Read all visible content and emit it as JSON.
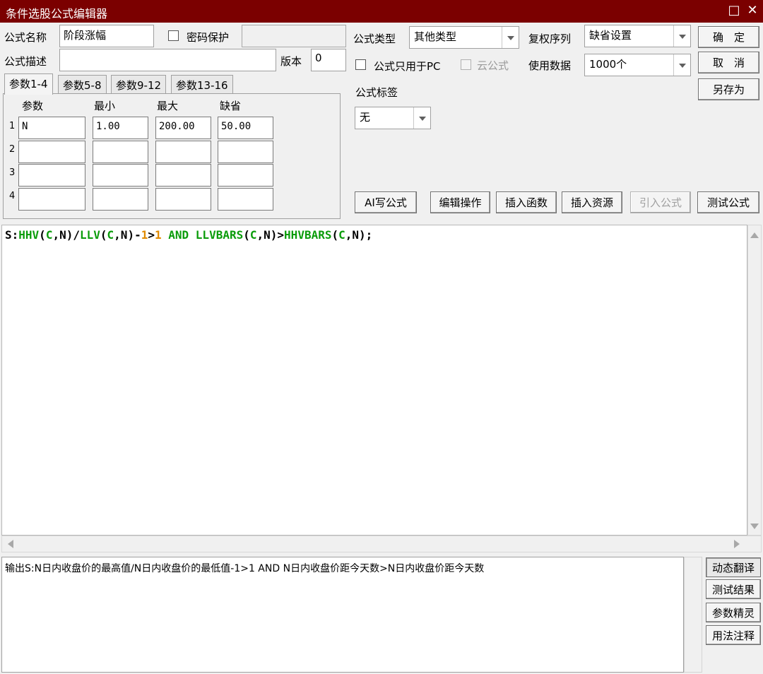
{
  "window": {
    "title": "条件选股公式编辑器",
    "titlebar_color": "#7b0000",
    "controls": {
      "maximize": "□",
      "close": "✕"
    }
  },
  "form": {
    "name_label": "公式名称",
    "name_value": "阶段涨幅",
    "password_label": "密码保护",
    "password_checked": false,
    "desc_label": "公式描述",
    "desc_value": "",
    "version_label": "版本",
    "version_value": "0",
    "type_label": "公式类型",
    "type_value": "其他类型",
    "restore_label": "复权序列",
    "restore_value": "缺省设置",
    "pc_only_label": "公式只用于PC",
    "pc_only_checked": false,
    "cloud_label": "云公式",
    "cloud_checked": false,
    "data_label": "使用数据",
    "data_value": "1000个",
    "tag_label": "公式标签",
    "tag_value": "无"
  },
  "buttons": {
    "ok": "确　定",
    "cancel": "取　消",
    "save_as": "另存为",
    "ai_write": "AI写公式",
    "edit_ops": "编辑操作",
    "insert_func": "插入函数",
    "insert_res": "插入资源",
    "import_formula": "引入公式",
    "test_formula": "测试公式"
  },
  "params": {
    "tabs": [
      "参数1-4",
      "参数5-8",
      "参数9-12",
      "参数13-16"
    ],
    "active_tab": 0,
    "headers": [
      "参数",
      "最小",
      "最大",
      "缺省"
    ],
    "rows": [
      {
        "num": "1",
        "name": "N",
        "min": "1.00",
        "max": "200.00",
        "default": "50.00"
      },
      {
        "num": "2",
        "name": "",
        "min": "",
        "max": "",
        "default": ""
      },
      {
        "num": "3",
        "name": "",
        "min": "",
        "max": "",
        "default": ""
      },
      {
        "num": "4",
        "name": "",
        "min": "",
        "max": "",
        "default": ""
      }
    ]
  },
  "editor": {
    "tokens": [
      {
        "t": "S:",
        "c": "black"
      },
      {
        "t": "HHV",
        "c": "green"
      },
      {
        "t": "(",
        "c": "black"
      },
      {
        "t": "C",
        "c": "green"
      },
      {
        "t": ",N)/",
        "c": "black"
      },
      {
        "t": "LLV",
        "c": "green"
      },
      {
        "t": "(",
        "c": "black"
      },
      {
        "t": "C",
        "c": "green"
      },
      {
        "t": ",N)-",
        "c": "black"
      },
      {
        "t": "1",
        "c": "orange"
      },
      {
        "t": ">",
        "c": "black"
      },
      {
        "t": "1",
        "c": "orange"
      },
      {
        "t": " AND ",
        "c": "green"
      },
      {
        "t": "LLVBARS",
        "c": "green"
      },
      {
        "t": "(",
        "c": "black"
      },
      {
        "t": "C",
        "c": "green"
      },
      {
        "t": ",N)>",
        "c": "black"
      },
      {
        "t": "HHVBARS",
        "c": "green"
      },
      {
        "t": "(",
        "c": "black"
      },
      {
        "t": "C",
        "c": "green"
      },
      {
        "t": ",N);",
        "c": "black"
      }
    ]
  },
  "output": {
    "text": "输出S:N日内收盘价的最高值/N日内收盘价的最低值-1>1 AND N日内收盘价距今天数>N日内收盘价距今天数"
  },
  "side_buttons": {
    "dynamic_translate": "动态翻译",
    "test_result": "测试结果",
    "param_wizard": "参数精灵",
    "usage_notes": "用法注释"
  }
}
